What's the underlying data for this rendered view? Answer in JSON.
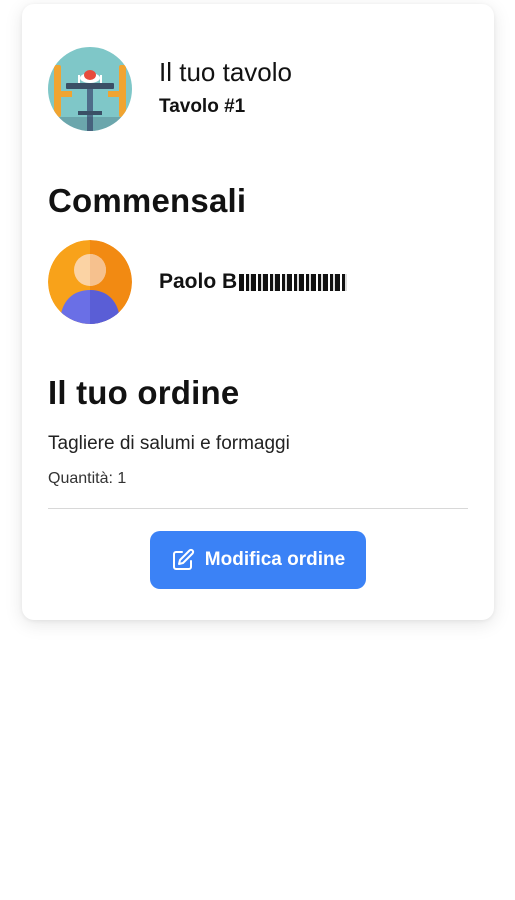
{
  "table": {
    "title": "Il tuo tavolo",
    "number": "Tavolo #1",
    "icon": "dining-table-icon"
  },
  "guests": {
    "heading": "Commensali",
    "items": [
      {
        "name": "Paolo B",
        "name_redacted": true,
        "icon": "user-avatar-icon"
      }
    ]
  },
  "order": {
    "heading": "Il tuo ordine",
    "items": [
      {
        "name": "Tagliere di salumi e formaggi",
        "quantity_label": "Quantità: 1"
      }
    ],
    "edit_button": {
      "label": "Modifica ordine",
      "icon": "edit-icon"
    }
  },
  "colors": {
    "primary_button": "#3b82f6",
    "avatar_orange": "#f7a21b",
    "avatar_blue": "#6b6ee0",
    "table_bg": "#7fc7c8"
  }
}
